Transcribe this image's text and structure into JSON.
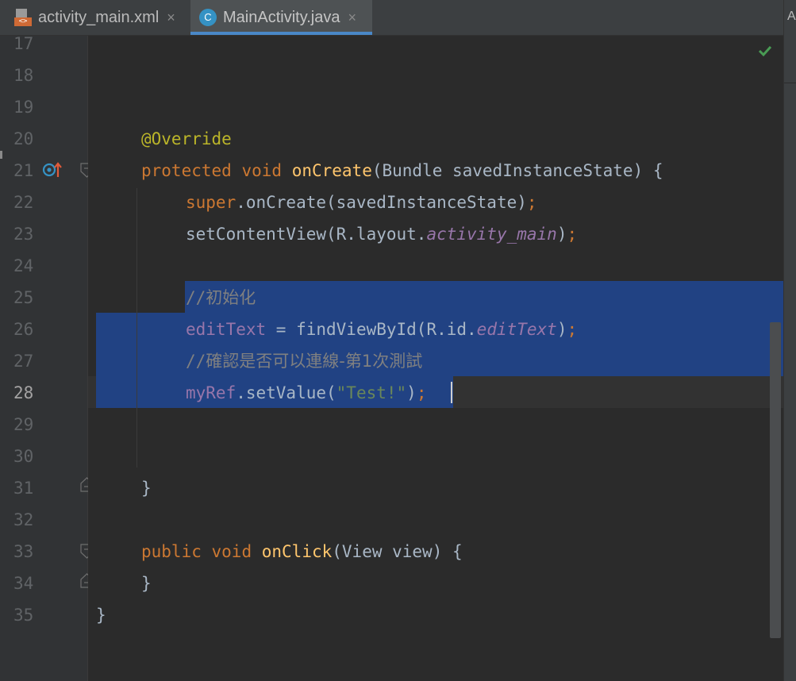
{
  "tabs": [
    {
      "label": "activity_main.xml",
      "close": "×",
      "icon_text": "<>",
      "icon": "xml-file-icon"
    },
    {
      "label": "MainActivity.java",
      "close": "×",
      "icon_text": "C",
      "icon": "java-class-icon"
    }
  ],
  "right_panel_letter": "A",
  "line_numbers": [
    "17",
    "18",
    "19",
    "20",
    "21",
    "22",
    "23",
    "24",
    "25",
    "26",
    "27",
    "28",
    "29",
    "30",
    "31",
    "32",
    "33",
    "34",
    "35"
  ],
  "current_line": "28",
  "code": {
    "l20": {
      "annotation": "@Override"
    },
    "l21": {
      "kw1": "protected",
      "kw2": "void",
      "method": "onCreate",
      "params": "(Bundle savedInstanceState) {"
    },
    "l22": {
      "kw": "super",
      "rest": ".onCreate(savedInstanceState)",
      "semi": ";"
    },
    "l23": {
      "pre": "setContentView(R.layout.",
      "field": "activity_main",
      "post": ")",
      "semi": ";"
    },
    "l25": {
      "slashes": "//",
      "text": "初始化"
    },
    "l26": {
      "field": "editText",
      "mid": " = findViewById(R.id.",
      "field2": "editText",
      "post": ")",
      "semi": ";"
    },
    "l27": {
      "slashes": "//",
      "text": "確認是否可以連線-第1次測試"
    },
    "l28": {
      "field": "myRef",
      "mid": ".setValue(",
      "str": "\"Test!\"",
      "post": ")",
      "semi": ";"
    },
    "l31": {
      "brace": "}"
    },
    "l33": {
      "kw1": "public",
      "kw2": "void",
      "method": "onClick",
      "params": "(View view) {"
    },
    "l34": {
      "brace": "}"
    },
    "l35": {
      "brace": "}"
    }
  },
  "colors": {
    "background": "#2b2b2b",
    "gutter": "#313335",
    "selection": "#214283",
    "keyword": "#cc7832",
    "annotation": "#bbb529",
    "method": "#ffc66d",
    "field": "#9876aa",
    "comment": "#808080",
    "string": "#6a8759",
    "accent": "#4a88c7"
  },
  "status": {
    "inspection_icon": "check-icon"
  }
}
